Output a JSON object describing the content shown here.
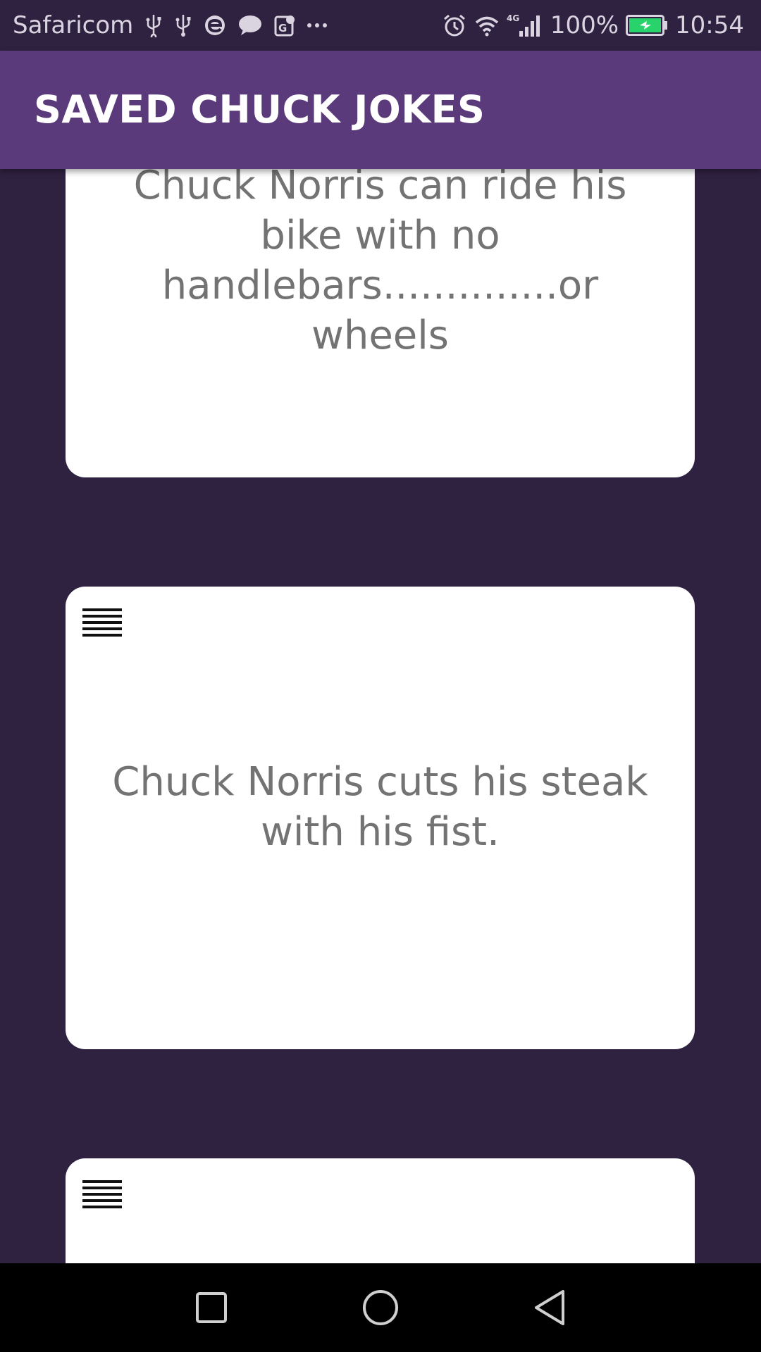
{
  "status_bar": {
    "carrier": "Safaricom",
    "left_icons": [
      "usb-icon",
      "usb-icon",
      "opera-icon",
      "chat-bubble-icon",
      "maps-icon",
      "more-dots-icon"
    ],
    "right_icons": [
      "alarm-icon",
      "wifi-icon",
      "signal-4g-icon",
      "battery-charging-icon"
    ],
    "network_type": "4G",
    "battery_percent": "100%",
    "time": "10:54"
  },
  "app_bar": {
    "title": "SAVED CHUCK JOKES",
    "color": "#5a3a7a"
  },
  "background_color": "#2f2140",
  "jokes": [
    {
      "text": "Chuck Norris can ride his bike with no handlebars..............or wheels",
      "handle_icon": "drag-handle-icon"
    },
    {
      "text": "Chuck Norris cuts his steak with his fist.",
      "handle_icon": "drag-handle-icon"
    },
    {
      "text": "",
      "handle_icon": "drag-handle-icon"
    }
  ],
  "nav_bar": {
    "buttons": [
      "recents-square-icon",
      "home-circle-icon",
      "back-triangle-icon"
    ]
  }
}
